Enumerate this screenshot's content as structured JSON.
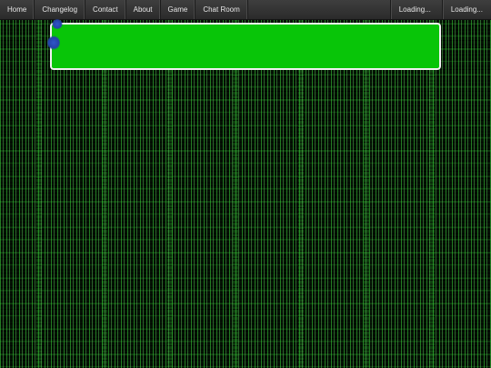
{
  "navbar": {
    "items": [
      {
        "label": "Home"
      },
      {
        "label": "Changelog"
      },
      {
        "label": "Contact"
      },
      {
        "label": "About"
      },
      {
        "label": "Game"
      },
      {
        "label": "Chat Room"
      }
    ],
    "right_items": [
      {
        "label": "Loading..."
      },
      {
        "label": "Loading..."
      }
    ]
  },
  "colors": {
    "banner": "#08c508",
    "navbar": "#333333",
    "background": "#041204"
  }
}
